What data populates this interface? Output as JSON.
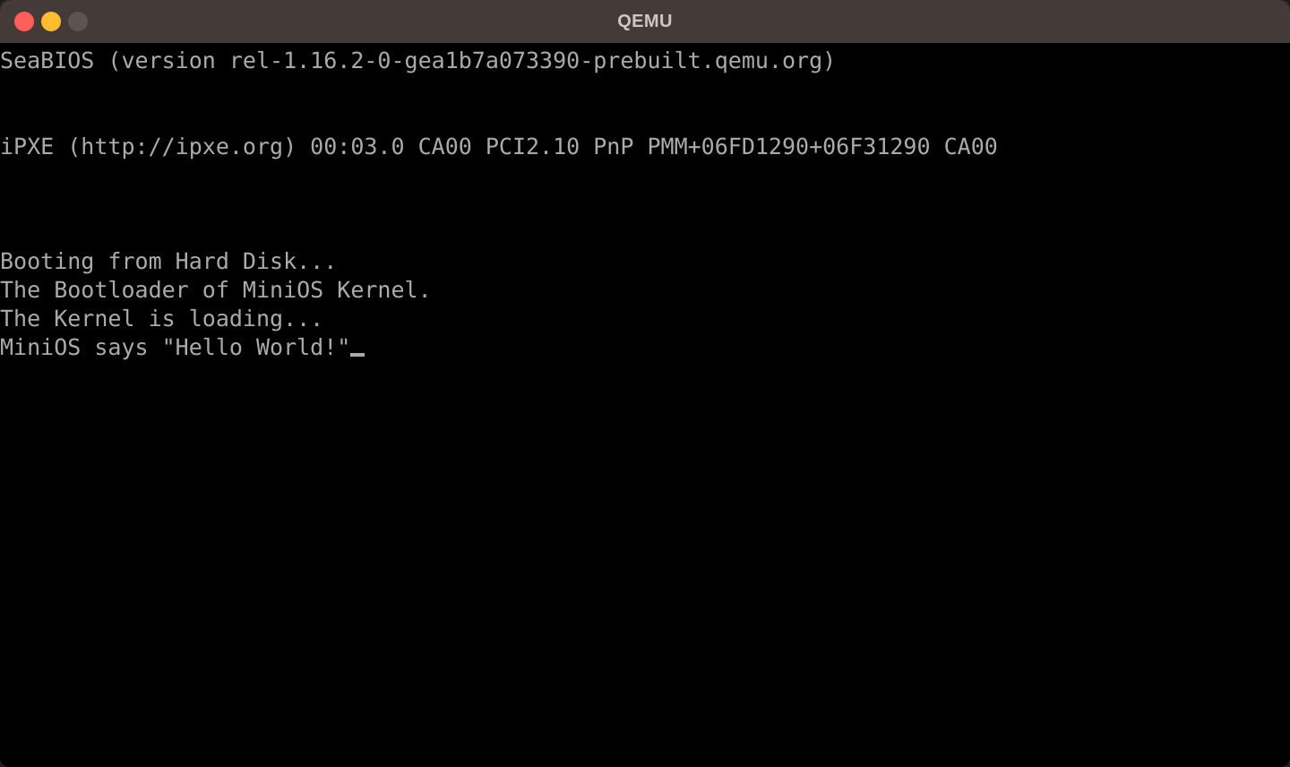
{
  "window": {
    "title": "QEMU",
    "traffic_lights": [
      {
        "name": "close",
        "color": "#ff5f57"
      },
      {
        "name": "minimize",
        "color": "#febc2e"
      },
      {
        "name": "zoom",
        "color": "#5d5350"
      }
    ],
    "titlebar_color": "#443a38",
    "console_bg": "#000000",
    "console_fg": "#aaaaaa"
  },
  "console": {
    "lines": [
      "SeaBIOS (version rel-1.16.2-0-gea1b7a073390-prebuilt.qemu.org)",
      "",
      "",
      "iPXE (http://ipxe.org) 00:03.0 CA00 PCI2.10 PnP PMM+06FD1290+06F31290 CA00",
      "",
      "",
      "",
      "Booting from Hard Disk...",
      "The Bootloader of MiniOS Kernel.",
      "The Kernel is loading...",
      "MiniOS says \"Hello World!\""
    ],
    "cursor_line_index": 10,
    "cursor_glyph": "block-underscore"
  }
}
